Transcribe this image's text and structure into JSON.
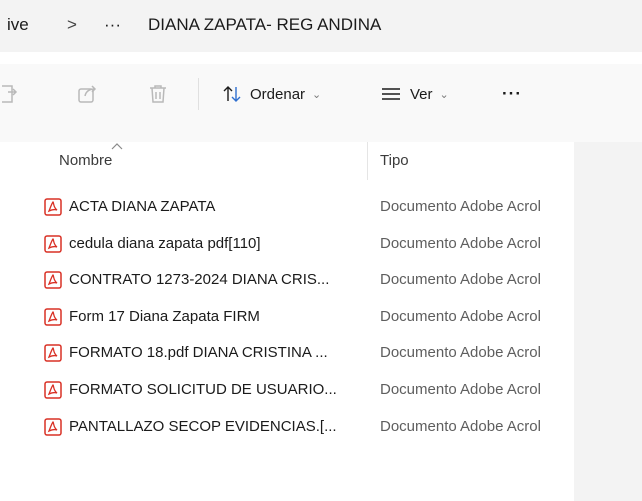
{
  "breadcrumb": {
    "prev": "ive",
    "separator": ">",
    "ellipsis": "···",
    "current": "DIANA ZAPATA- REG ANDINA"
  },
  "toolbar": {
    "sort_label": "Ordenar",
    "view_label": "Ver",
    "more": "···"
  },
  "columns": {
    "name": "Nombre",
    "type": "Tipo"
  },
  "files": [
    {
      "name": "ACTA DIANA ZAPATA",
      "type": "Documento Adobe Acrol"
    },
    {
      "name": "cedula diana zapata pdf[110]",
      "type": "Documento Adobe Acrol"
    },
    {
      "name": "CONTRATO 1273-2024 DIANA CRIS...",
      "type": "Documento Adobe Acrol"
    },
    {
      "name": "Form 17 Diana Zapata FIRM",
      "type": "Documento Adobe Acrol"
    },
    {
      "name": "FORMATO 18.pdf DIANA CRISTINA ...",
      "type": "Documento Adobe Acrol"
    },
    {
      "name": "FORMATO SOLICITUD DE USUARIO...",
      "type": "Documento Adobe Acrol"
    },
    {
      "name": "PANTALLAZO SECOP EVIDENCIAS.[...",
      "type": "Documento Adobe Acrol"
    }
  ],
  "icons": {
    "file": "pdf-file-icon",
    "pdf_color": "#d93025"
  }
}
